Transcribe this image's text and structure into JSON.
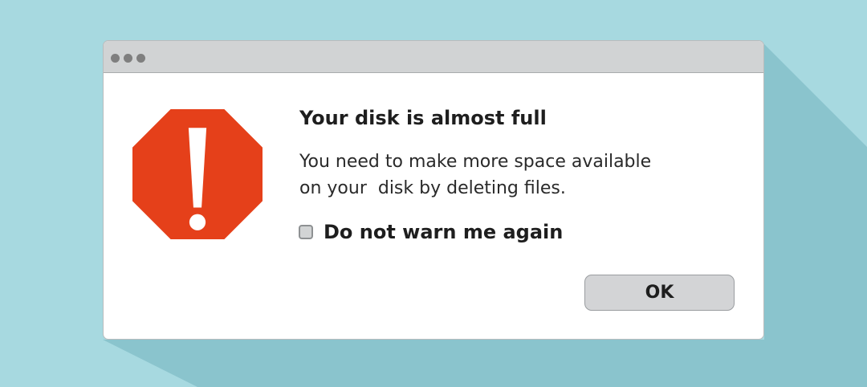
{
  "dialog": {
    "title": "Your disk is almost full",
    "message_lines": [
      "You need to make more space available",
      "on your  disk by deleting files."
    ],
    "checkbox": {
      "label": "Do not warn me again",
      "checked": false
    },
    "ok_label": "OK",
    "icon": "stop-warning-icon"
  },
  "colors": {
    "background": "#a7d9e0",
    "shadow": "#8ac4cd",
    "titlebar": "#d1d3d4",
    "window_controls": "#7f7f7f",
    "stop_icon": "#e5401a",
    "button": "#d3d4d6"
  }
}
